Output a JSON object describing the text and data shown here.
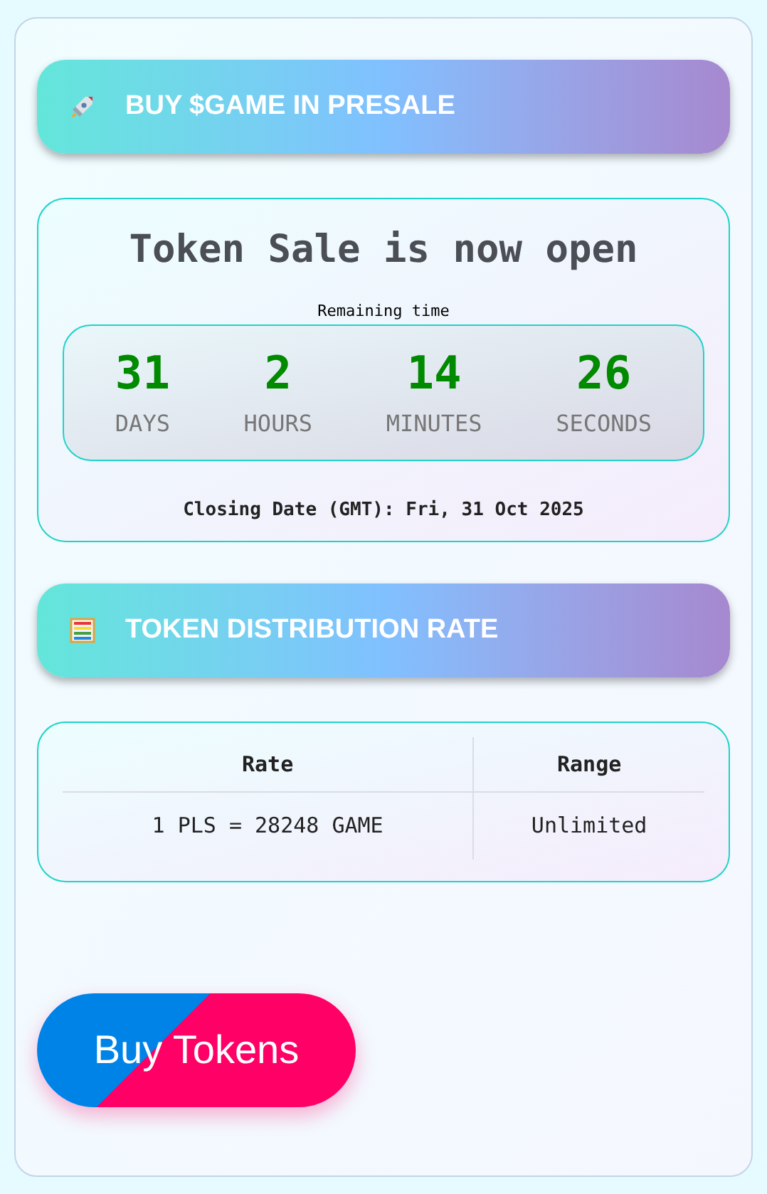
{
  "presale_header": {
    "title": "BUY $GAME IN PRESALE"
  },
  "countdown": {
    "title": "Token Sale is now open",
    "caption": "Remaining time",
    "units": [
      {
        "value": "31",
        "label": "DAYS"
      },
      {
        "value": "2",
        "label": "HOURS"
      },
      {
        "value": "14",
        "label": "MINUTES"
      },
      {
        "value": "26",
        "label": "SECONDS"
      }
    ],
    "closing_date": "Closing Date (GMT): Fri, 31 Oct 2025"
  },
  "distribution_header": {
    "title": "TOKEN DISTRIBUTION RATE"
  },
  "rate_table": {
    "columns": [
      "Rate",
      "Range"
    ],
    "rows": [
      [
        "1 PLS = 28248 GAME",
        "Unlimited"
      ]
    ]
  },
  "buy_button": {
    "label": "Buy Tokens"
  }
}
